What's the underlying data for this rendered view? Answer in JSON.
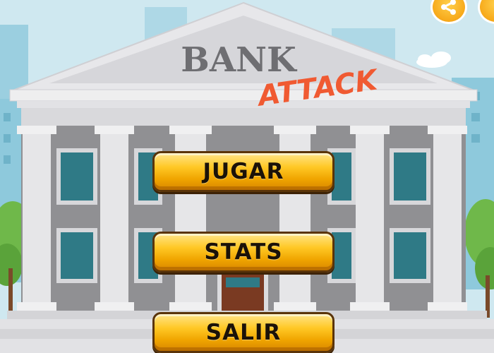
{
  "building": {
    "sign_text": "BANK",
    "logo_word": "ATTACK",
    "colors": {
      "sky": "#cfe8f0",
      "stone": "#e4e4e6",
      "pediment": "#dcdcdf",
      "logo": "#f05a32"
    }
  },
  "menu": {
    "play_label": "JUGAR",
    "stats_label": "STATS",
    "exit_label": "SALIR",
    "button_color": "#ffc825"
  },
  "top_buttons": {
    "share_icon": "share-icon",
    "extra_icon": "partial-round-icon"
  }
}
